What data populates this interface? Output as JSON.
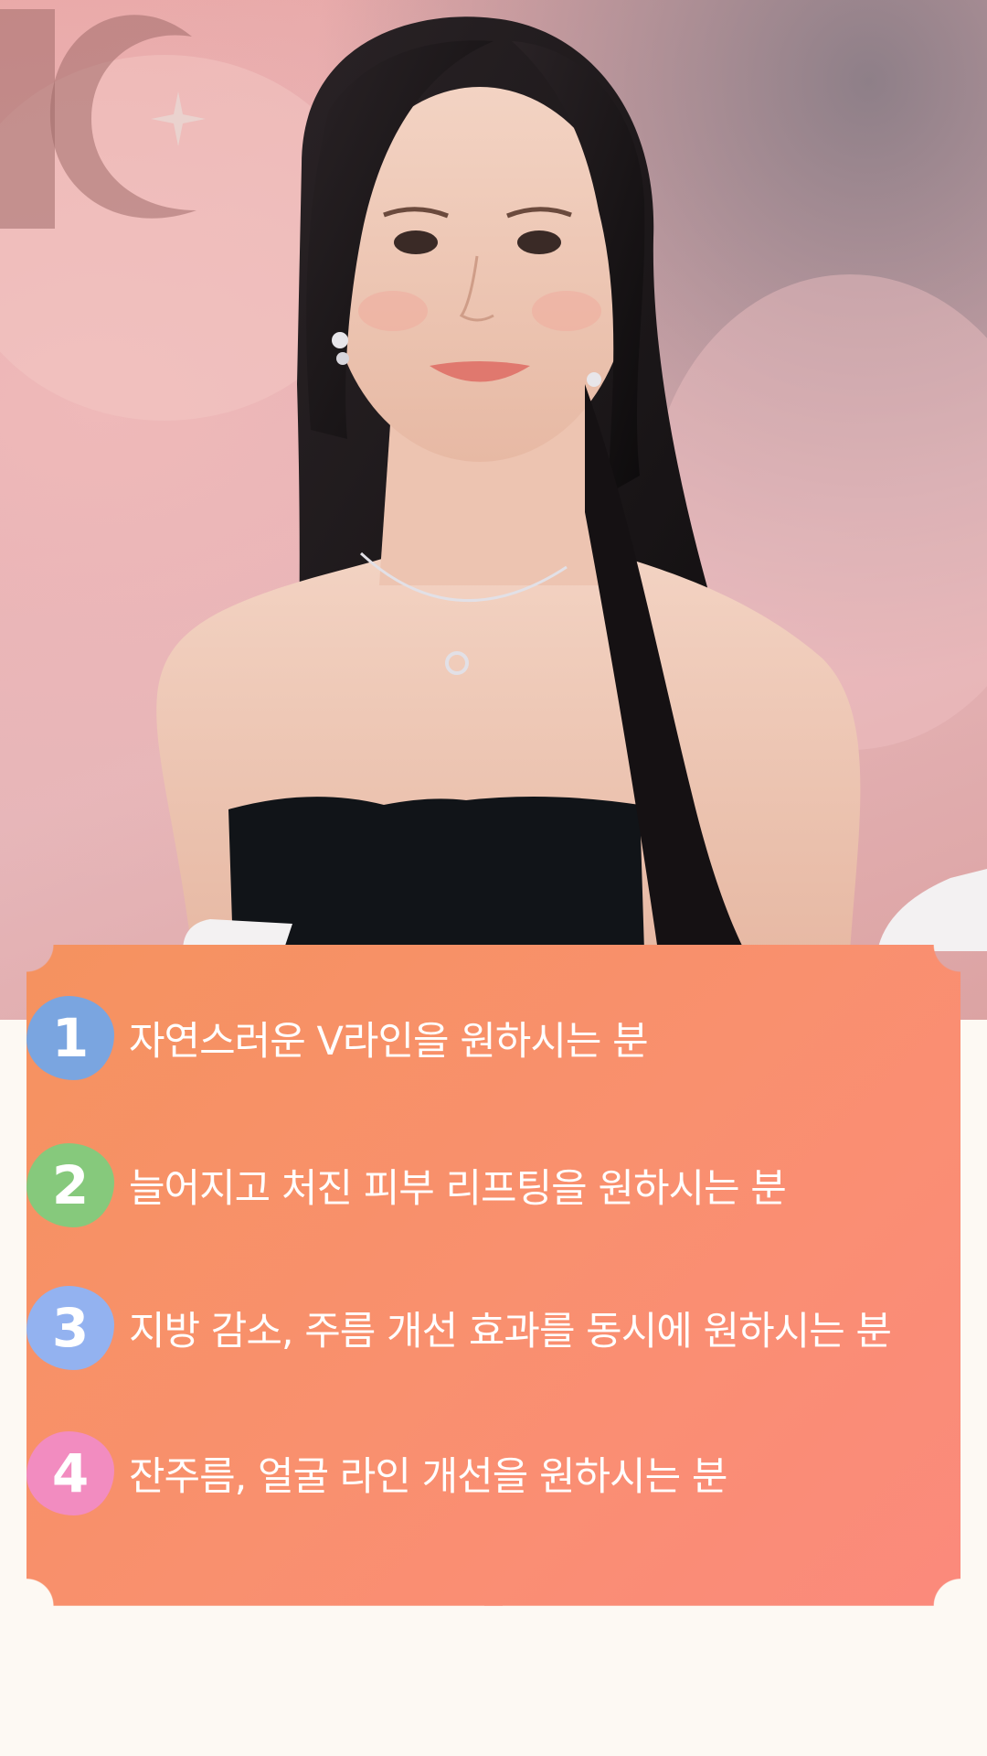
{
  "items": [
    {
      "number": "1",
      "text": "자연스러운 V라인을 원하시는 분",
      "badge_color": "#7aa5e0"
    },
    {
      "number": "2",
      "text": "늘어지고 처진 피부 리프팅을 원하시는 분",
      "badge_color": "#86c97c"
    },
    {
      "number": "3",
      "text": "지방 감소, 주름 개선 효과를 동시에 원하시는 분",
      "badge_color": "#93b2f0"
    },
    {
      "number": "4",
      "text": "잔주름, 얼굴 라인 개선을 원하시는 분",
      "badge_color": "#f28cc0"
    }
  ],
  "colors": {
    "page_background": "#fdf9f3",
    "card_gradient_start": "#f5925f",
    "card_gradient_end": "#fb8a7c",
    "text": "#ffffff"
  },
  "icons": {
    "logo": "moon-star-logo-icon"
  }
}
